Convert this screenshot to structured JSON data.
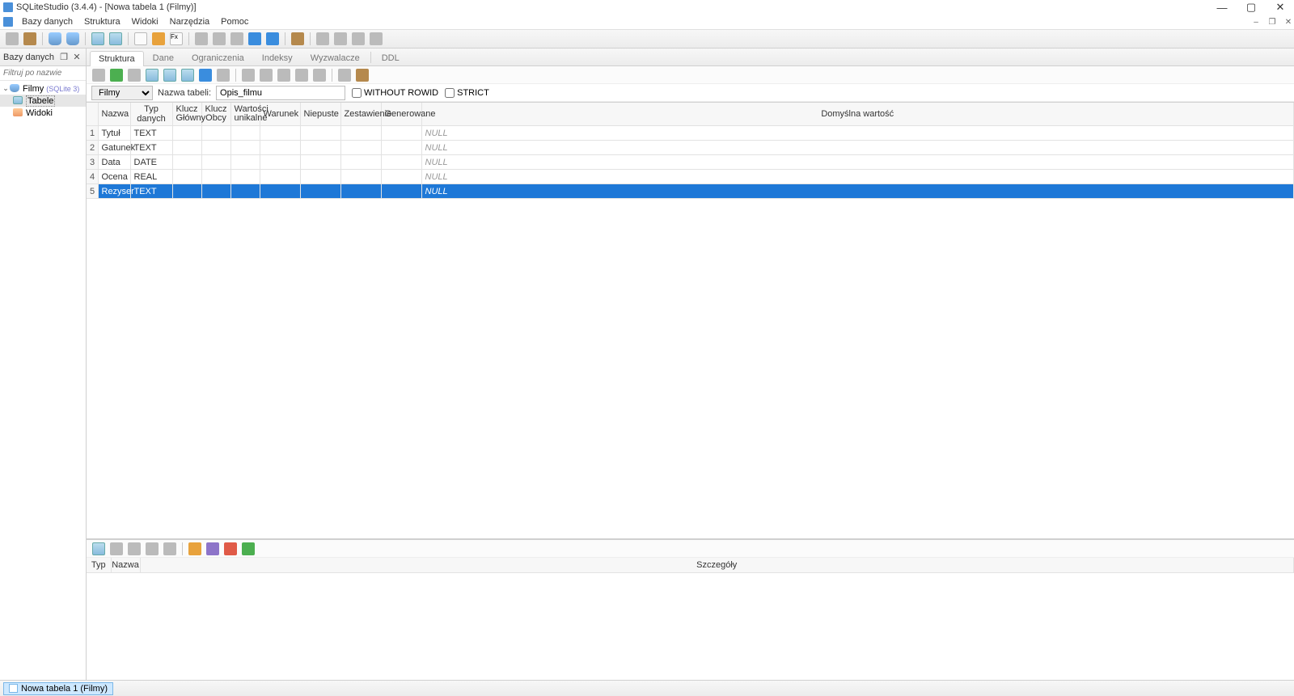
{
  "title": "SQLiteStudio (3.4.4) - [Nowa tabela 1 (Filmy)]",
  "menu": {
    "items": [
      "Bazy danych",
      "Struktura",
      "Widoki",
      "Narzędzia",
      "Pomoc"
    ]
  },
  "sidebar": {
    "title": "Bazy danych",
    "filter_placeholder": "Filtruj po nazwie",
    "db": {
      "name": "Filmy",
      "driver": "(SQLite 3)"
    },
    "nodes": {
      "tables": "Tabele",
      "views": "Widoki"
    }
  },
  "tabs": [
    "Struktura",
    "Dane",
    "Ograniczenia",
    "Indeksy",
    "Wyzwalacze",
    "DDL"
  ],
  "tableRow": {
    "db_selected": "Filmy",
    "label": "Nazwa tabeli:",
    "table_name": "Opis_filmu",
    "without_rowid": "WITHOUT ROWID",
    "strict": "STRICT"
  },
  "cols": {
    "headers": {
      "name": "Nazwa",
      "type": "Typ danych",
      "pk1": "Klucz",
      "pk2": "Główny",
      "fk1": "Klucz",
      "fk2": "Obcy",
      "uniq1": "Wartości",
      "uniq2": "unikalne",
      "chk": "Warunek",
      "nn": "Niepuste",
      "coll": "Zestawienie",
      "gen": "Generowane",
      "def": "Domyślna wartość"
    },
    "rows": [
      {
        "n": "1",
        "name": "Tytuł",
        "type": "TEXT",
        "def": "NULL"
      },
      {
        "n": "2",
        "name": "Gatunek",
        "type": "TEXT",
        "def": "NULL"
      },
      {
        "n": "3",
        "name": "Data",
        "type": "DATE",
        "def": "NULL"
      },
      {
        "n": "4",
        "name": "Ocena",
        "type": "REAL",
        "def": "NULL"
      },
      {
        "n": "5",
        "name": "Rezyser",
        "type": "TEXT",
        "def": "NULL",
        "selected": true
      }
    ]
  },
  "bottom": {
    "headers": {
      "typ": "Typ",
      "nazwa": "Nazwa",
      "details": "Szczegóły"
    }
  },
  "status": {
    "tab": "Nowa tabela 1 (Filmy)"
  }
}
